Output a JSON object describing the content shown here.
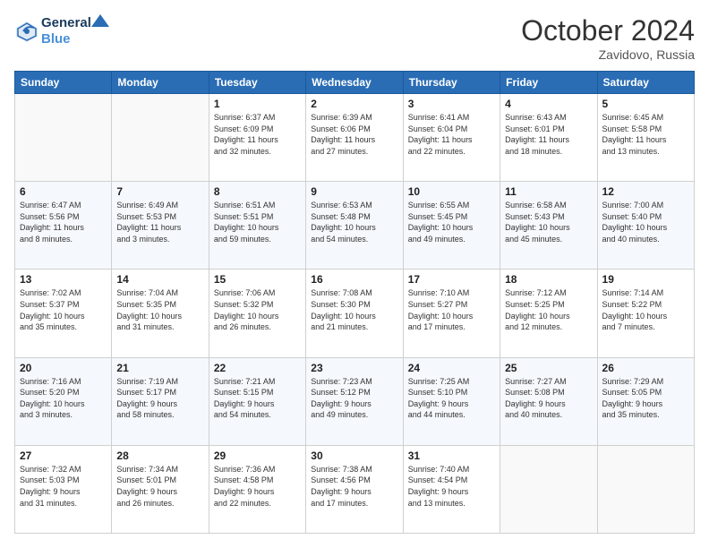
{
  "header": {
    "logo_line1": "General",
    "logo_line2": "Blue",
    "month": "October 2024",
    "location": "Zavidovo, Russia"
  },
  "days_of_week": [
    "Sunday",
    "Monday",
    "Tuesday",
    "Wednesday",
    "Thursday",
    "Friday",
    "Saturday"
  ],
  "weeks": [
    [
      {
        "num": "",
        "info": ""
      },
      {
        "num": "",
        "info": ""
      },
      {
        "num": "1",
        "info": "Sunrise: 6:37 AM\nSunset: 6:09 PM\nDaylight: 11 hours\nand 32 minutes."
      },
      {
        "num": "2",
        "info": "Sunrise: 6:39 AM\nSunset: 6:06 PM\nDaylight: 11 hours\nand 27 minutes."
      },
      {
        "num": "3",
        "info": "Sunrise: 6:41 AM\nSunset: 6:04 PM\nDaylight: 11 hours\nand 22 minutes."
      },
      {
        "num": "4",
        "info": "Sunrise: 6:43 AM\nSunset: 6:01 PM\nDaylight: 11 hours\nand 18 minutes."
      },
      {
        "num": "5",
        "info": "Sunrise: 6:45 AM\nSunset: 5:58 PM\nDaylight: 11 hours\nand 13 minutes."
      }
    ],
    [
      {
        "num": "6",
        "info": "Sunrise: 6:47 AM\nSunset: 5:56 PM\nDaylight: 11 hours\nand 8 minutes."
      },
      {
        "num": "7",
        "info": "Sunrise: 6:49 AM\nSunset: 5:53 PM\nDaylight: 11 hours\nand 3 minutes."
      },
      {
        "num": "8",
        "info": "Sunrise: 6:51 AM\nSunset: 5:51 PM\nDaylight: 10 hours\nand 59 minutes."
      },
      {
        "num": "9",
        "info": "Sunrise: 6:53 AM\nSunset: 5:48 PM\nDaylight: 10 hours\nand 54 minutes."
      },
      {
        "num": "10",
        "info": "Sunrise: 6:55 AM\nSunset: 5:45 PM\nDaylight: 10 hours\nand 49 minutes."
      },
      {
        "num": "11",
        "info": "Sunrise: 6:58 AM\nSunset: 5:43 PM\nDaylight: 10 hours\nand 45 minutes."
      },
      {
        "num": "12",
        "info": "Sunrise: 7:00 AM\nSunset: 5:40 PM\nDaylight: 10 hours\nand 40 minutes."
      }
    ],
    [
      {
        "num": "13",
        "info": "Sunrise: 7:02 AM\nSunset: 5:37 PM\nDaylight: 10 hours\nand 35 minutes."
      },
      {
        "num": "14",
        "info": "Sunrise: 7:04 AM\nSunset: 5:35 PM\nDaylight: 10 hours\nand 31 minutes."
      },
      {
        "num": "15",
        "info": "Sunrise: 7:06 AM\nSunset: 5:32 PM\nDaylight: 10 hours\nand 26 minutes."
      },
      {
        "num": "16",
        "info": "Sunrise: 7:08 AM\nSunset: 5:30 PM\nDaylight: 10 hours\nand 21 minutes."
      },
      {
        "num": "17",
        "info": "Sunrise: 7:10 AM\nSunset: 5:27 PM\nDaylight: 10 hours\nand 17 minutes."
      },
      {
        "num": "18",
        "info": "Sunrise: 7:12 AM\nSunset: 5:25 PM\nDaylight: 10 hours\nand 12 minutes."
      },
      {
        "num": "19",
        "info": "Sunrise: 7:14 AM\nSunset: 5:22 PM\nDaylight: 10 hours\nand 7 minutes."
      }
    ],
    [
      {
        "num": "20",
        "info": "Sunrise: 7:16 AM\nSunset: 5:20 PM\nDaylight: 10 hours\nand 3 minutes."
      },
      {
        "num": "21",
        "info": "Sunrise: 7:19 AM\nSunset: 5:17 PM\nDaylight: 9 hours\nand 58 minutes."
      },
      {
        "num": "22",
        "info": "Sunrise: 7:21 AM\nSunset: 5:15 PM\nDaylight: 9 hours\nand 54 minutes."
      },
      {
        "num": "23",
        "info": "Sunrise: 7:23 AM\nSunset: 5:12 PM\nDaylight: 9 hours\nand 49 minutes."
      },
      {
        "num": "24",
        "info": "Sunrise: 7:25 AM\nSunset: 5:10 PM\nDaylight: 9 hours\nand 44 minutes."
      },
      {
        "num": "25",
        "info": "Sunrise: 7:27 AM\nSunset: 5:08 PM\nDaylight: 9 hours\nand 40 minutes."
      },
      {
        "num": "26",
        "info": "Sunrise: 7:29 AM\nSunset: 5:05 PM\nDaylight: 9 hours\nand 35 minutes."
      }
    ],
    [
      {
        "num": "27",
        "info": "Sunrise: 7:32 AM\nSunset: 5:03 PM\nDaylight: 9 hours\nand 31 minutes."
      },
      {
        "num": "28",
        "info": "Sunrise: 7:34 AM\nSunset: 5:01 PM\nDaylight: 9 hours\nand 26 minutes."
      },
      {
        "num": "29",
        "info": "Sunrise: 7:36 AM\nSunset: 4:58 PM\nDaylight: 9 hours\nand 22 minutes."
      },
      {
        "num": "30",
        "info": "Sunrise: 7:38 AM\nSunset: 4:56 PM\nDaylight: 9 hours\nand 17 minutes."
      },
      {
        "num": "31",
        "info": "Sunrise: 7:40 AM\nSunset: 4:54 PM\nDaylight: 9 hours\nand 13 minutes."
      },
      {
        "num": "",
        "info": ""
      },
      {
        "num": "",
        "info": ""
      }
    ]
  ]
}
